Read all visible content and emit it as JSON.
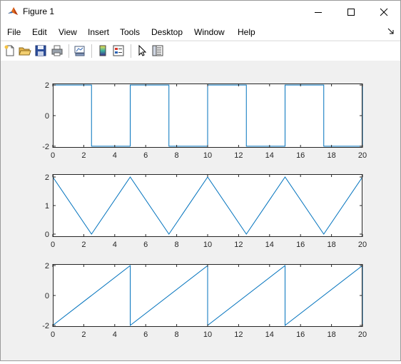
{
  "window": {
    "title": "Figure 1",
    "icon": "matlab-icon"
  },
  "menu": [
    "File",
    "Edit",
    "View",
    "Insert",
    "Tools",
    "Desktop",
    "Window",
    "Help"
  ],
  "toolbar": {
    "icons": [
      "new-figure-icon",
      "open-file-icon",
      "save-icon",
      "print-icon",
      "link-plot-icon",
      "insert-colorbar-icon",
      "insert-legend-icon",
      "edit-plot-icon",
      "property-inspector-icon"
    ]
  },
  "colors": {
    "line": "#0072bd",
    "figure_bg": "#f0f0f0",
    "axes_bg": "#ffffff",
    "axis": "#262626"
  },
  "chart_data": [
    {
      "type": "line",
      "title": "",
      "xlabel": "",
      "ylabel": "",
      "xlim": [
        0,
        20
      ],
      "ylim": [
        -2.1,
        2.1
      ],
      "xticks": [
        0,
        2,
        4,
        6,
        8,
        10,
        12,
        14,
        16,
        18,
        20
      ],
      "yticks": [
        -2,
        0,
        2
      ],
      "series": [
        {
          "x": [
            0,
            2.5,
            2.5,
            5,
            5,
            7.5,
            7.5,
            10,
            10,
            12.5,
            12.5,
            15,
            15,
            17.5,
            17.5,
            20,
            20
          ],
          "y": [
            2,
            2,
            -2,
            -2,
            2,
            2,
            -2,
            -2,
            2,
            2,
            -2,
            -2,
            2,
            2,
            -2,
            -2,
            2
          ]
        }
      ]
    },
    {
      "type": "line",
      "title": "",
      "xlabel": "",
      "ylabel": "",
      "xlim": [
        0,
        20
      ],
      "ylim": [
        -0.1,
        2.1
      ],
      "xticks": [
        0,
        2,
        4,
        6,
        8,
        10,
        12,
        14,
        16,
        18,
        20
      ],
      "yticks": [
        0,
        1,
        2
      ],
      "series": [
        {
          "x": [
            0,
            2.5,
            5,
            7.5,
            10,
            12.5,
            15,
            17.5,
            20
          ],
          "y": [
            2,
            0,
            2,
            0,
            2,
            0,
            2,
            0,
            2
          ]
        }
      ]
    },
    {
      "type": "line",
      "title": "",
      "xlabel": "",
      "ylabel": "",
      "xlim": [
        0,
        20
      ],
      "ylim": [
        -2.1,
        2.1
      ],
      "xticks": [
        0,
        2,
        4,
        6,
        8,
        10,
        12,
        14,
        16,
        18,
        20
      ],
      "yticks": [
        -2,
        0,
        2
      ],
      "series": [
        {
          "x": [
            0,
            5,
            5,
            10,
            10,
            15,
            15,
            20,
            20
          ],
          "y": [
            -2,
            2,
            -2,
            2,
            -2,
            2,
            -2,
            2,
            -2
          ]
        }
      ]
    }
  ]
}
